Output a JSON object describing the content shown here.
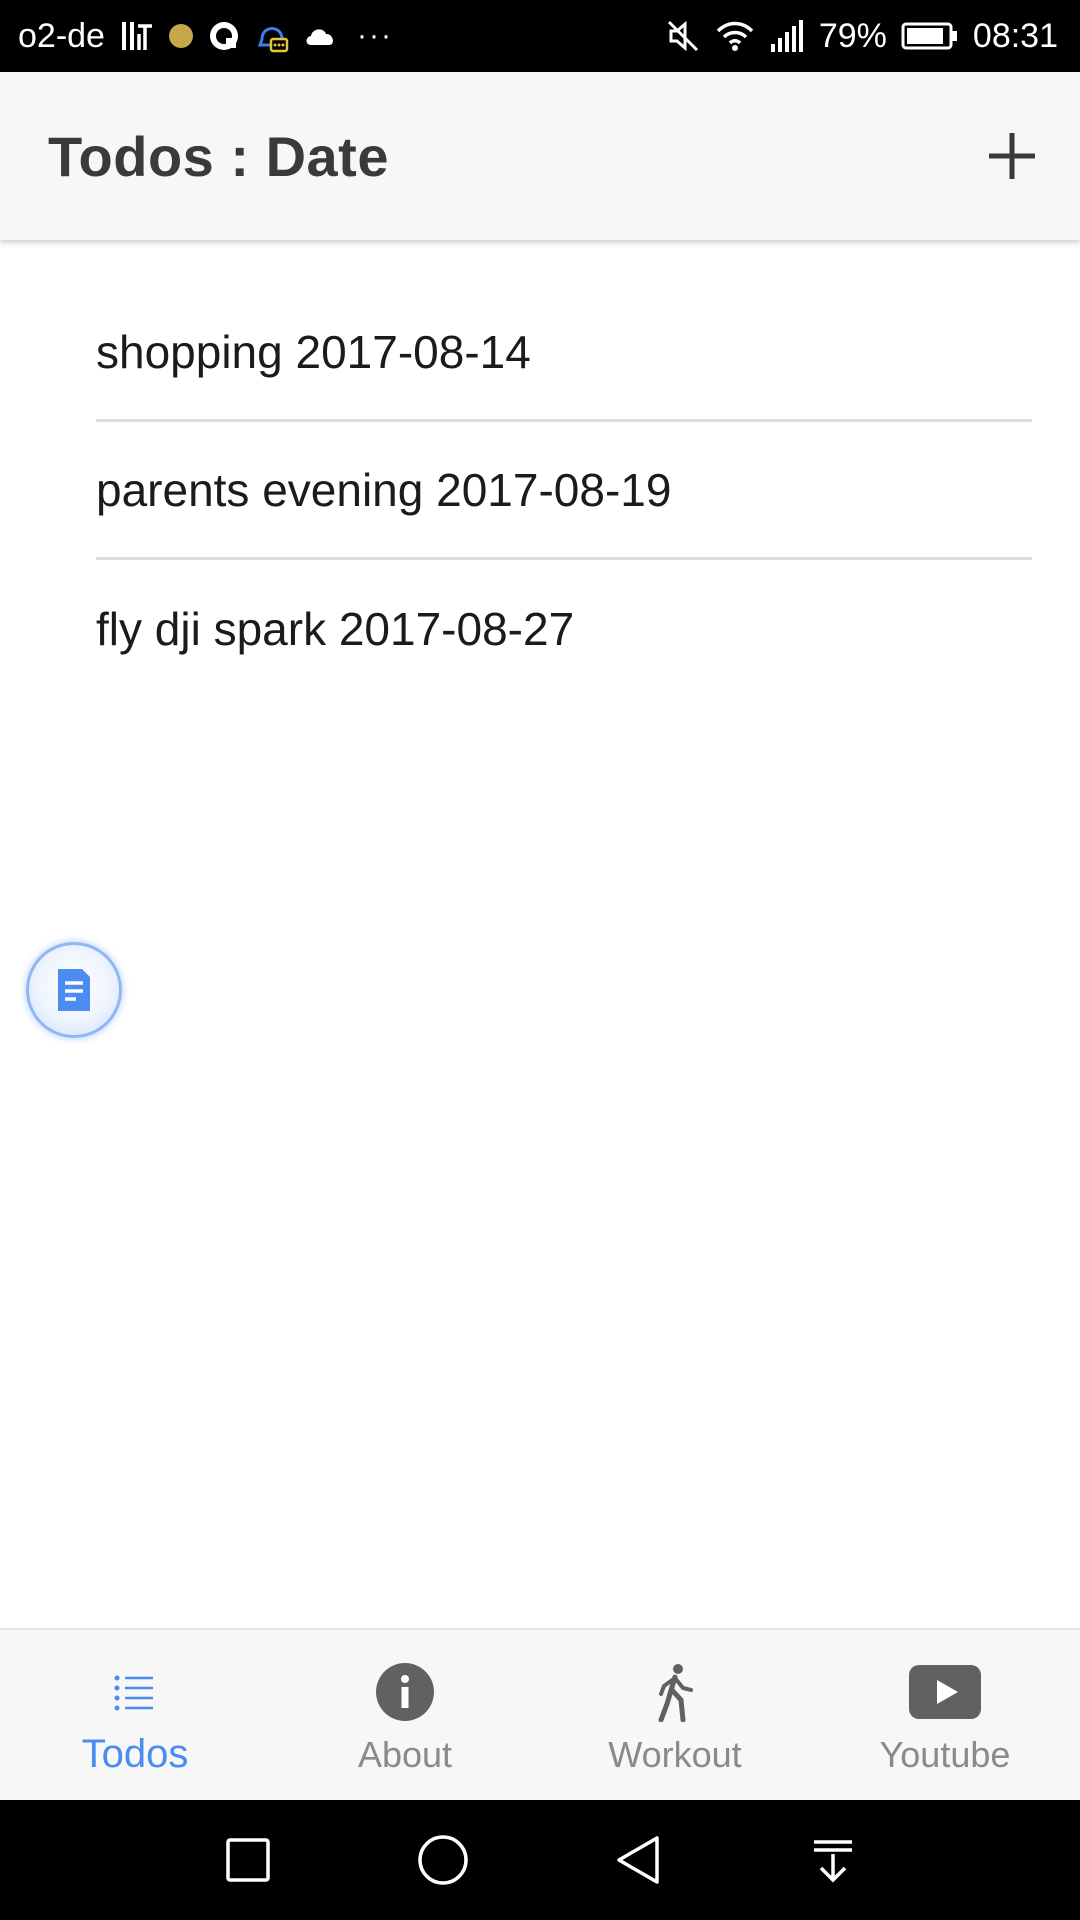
{
  "status_bar": {
    "carrier": "o2-de",
    "battery": "79%",
    "time": "08:31",
    "left_icons": [
      "hd-voice-icon",
      "notification-dot-icon",
      "chat-icon",
      "messenger-icon",
      "cloud-icon"
    ],
    "ellipsis": "···",
    "right_icons": [
      "mute-icon",
      "wifi-icon",
      "signal-icon",
      "battery-icon"
    ]
  },
  "app_bar": {
    "title": "Todos : Date",
    "add_icon": "plus-icon"
  },
  "todos": [
    "shopping 2017-08-14",
    "parents evening 2017-08-19",
    "fly dji spark 2017-08-27"
  ],
  "floating_button": {
    "icon": "document-icon"
  },
  "tabs": [
    {
      "label": "Todos",
      "icon": "list-icon",
      "active": true
    },
    {
      "label": "About",
      "icon": "info-icon",
      "active": false
    },
    {
      "label": "Workout",
      "icon": "walk-icon",
      "active": false
    },
    {
      "label": "Youtube",
      "icon": "youtube-icon",
      "active": false
    }
  ],
  "nav_bar": {
    "buttons": [
      "recents-square-icon",
      "home-circle-icon",
      "back-triangle-icon",
      "notification-pulldown-icon"
    ]
  },
  "colors": {
    "accent": "#4a8cf0",
    "app_bar_bg": "#f7f7f7",
    "tab_inactive": "#8a8a8a",
    "icon_gray": "#616161"
  }
}
